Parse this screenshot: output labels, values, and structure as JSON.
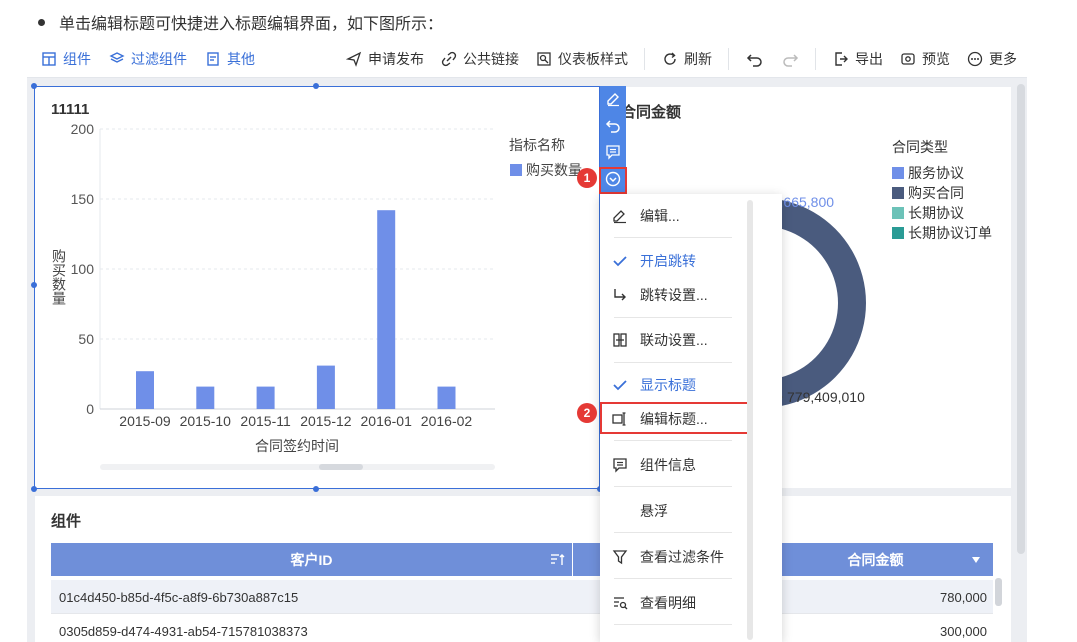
{
  "intro": {
    "text": "单击编辑标题可快捷进入标题编辑界面，如下图所示："
  },
  "toolbar": {
    "left": [
      {
        "label": "组件",
        "icon": "component-icon"
      },
      {
        "label": "过滤组件",
        "icon": "filter-component-icon"
      },
      {
        "label": "其他",
        "icon": "other-icon"
      }
    ],
    "right": [
      {
        "label": "申请发布",
        "icon": "send-icon"
      },
      {
        "label": "公共链接",
        "icon": "link-icon"
      },
      {
        "label": "仪表板样式",
        "icon": "style-icon"
      },
      {
        "label": "刷新",
        "icon": "refresh-icon"
      },
      {
        "label": "导出",
        "icon": "export-icon"
      },
      {
        "label": "预览",
        "icon": "preview-icon"
      },
      {
        "label": "更多",
        "icon": "more-icon"
      }
    ]
  },
  "bar_widget": {
    "title": "11111",
    "legend_title": "指标名称",
    "legend_color": "#6f8fe8"
  },
  "chart_data": [
    {
      "type": "bar",
      "title": "11111",
      "xlabel": "合同签约时间",
      "ylabel": "购买数量",
      "categories": [
        "2015-09",
        "2015-10",
        "2015-11",
        "2015-12",
        "2016-01",
        "2016-02"
      ],
      "series": [
        {
          "name": "购买数量",
          "values": [
            27,
            16,
            16,
            31,
            142,
            16
          ]
        }
      ],
      "ylim": [
        0,
        200
      ],
      "yticks": [
        0,
        50,
        100,
        150,
        200
      ],
      "grid": true,
      "legend": "top-right"
    },
    {
      "type": "pie",
      "title": "合同金额",
      "legend_title": "合同类型",
      "categories": [
        "服务协议",
        "购买合同",
        "长期协议",
        "长期协议订单"
      ],
      "data_labels": [
        "11,665,800",
        "779,409,010"
      ],
      "values": [
        11665800,
        779409010
      ],
      "legend": "right"
    }
  ],
  "pie_widget": {
    "title": "合同金额",
    "legend_title": "合同类型",
    "legend": [
      {
        "label": "服务协议",
        "color": "#6f8fe8"
      },
      {
        "label": "购买合同",
        "color": "#4a5b7e"
      },
      {
        "label": "长期协议",
        "color": "#6cc2b8"
      },
      {
        "label": "长期协议订单",
        "color": "#2a9b95"
      }
    ],
    "label_small": "11,665,800",
    "label_large": "779,409,010",
    "ring_color": "#4a5b7e"
  },
  "badges": {
    "one": "1",
    "two": "2"
  },
  "menu": {
    "items": [
      {
        "label": "编辑...",
        "icon": "edit-icon"
      },
      {
        "label": "开启跳转",
        "icon": "check-icon"
      },
      {
        "label": "跳转设置...",
        "icon": "jump-icon"
      },
      {
        "label": "联动设置...",
        "icon": "linkage-icon"
      },
      {
        "label": "显示标题",
        "icon": "check-icon"
      },
      {
        "label": "编辑标题...",
        "icon": "edit-title-icon"
      },
      {
        "label": "组件信息",
        "icon": "info-icon"
      },
      {
        "label": "悬浮",
        "icon": ""
      },
      {
        "label": "查看过滤条件",
        "icon": "filter-icon"
      },
      {
        "label": "查看明细",
        "icon": "detail-icon"
      }
    ]
  },
  "table_widget": {
    "title": "组件",
    "headers": [
      "客户ID",
      "",
      "合同金额"
    ],
    "rows": [
      {
        "id": "01c4d450-b85d-4f5c-a8f9-6b730a887c15",
        "amount": "780,000"
      },
      {
        "id": "0305d859-d474-4931-ab54-715781038373",
        "amount": "300,000"
      }
    ]
  },
  "colors": {
    "accent": "#3a70d8",
    "highlight": "#e53935",
    "header_bg": "#6f8fd9"
  }
}
